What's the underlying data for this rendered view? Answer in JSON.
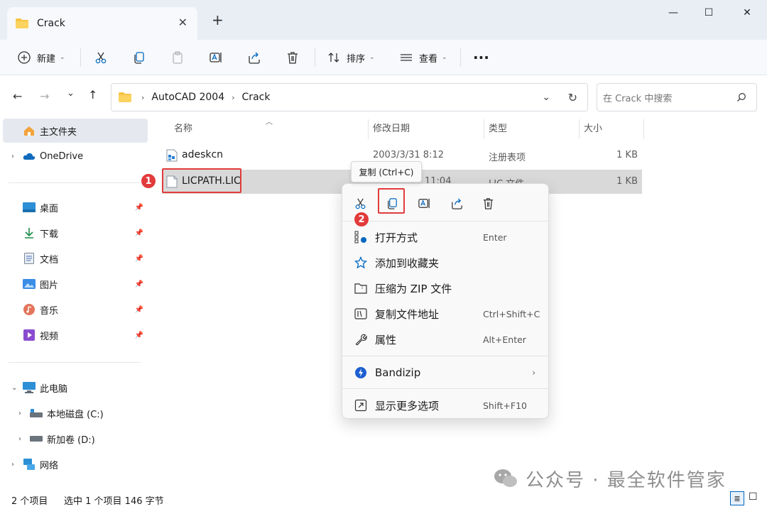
{
  "window": {
    "tab_title": "Crack",
    "new_tab": "+",
    "tab_close": "✕",
    "minimize": "—",
    "maximize": "☐",
    "close": "✕"
  },
  "toolbar": {
    "new_label": "新建",
    "sort_label": "排序",
    "view_label": "查看",
    "more": "···"
  },
  "address": {
    "segments": [
      "AutoCAD 2004",
      "Crack"
    ],
    "search_placeholder": "在 Crack 中搜索"
  },
  "sidebar": {
    "home": "主文件夹",
    "onedrive": "OneDrive",
    "quick": [
      {
        "label": "桌面",
        "icon": "desktop-icon"
      },
      {
        "label": "下载",
        "icon": "download-icon"
      },
      {
        "label": "文档",
        "icon": "document-icon"
      },
      {
        "label": "图片",
        "icon": "pictures-icon"
      },
      {
        "label": "音乐",
        "icon": "music-icon"
      },
      {
        "label": "视频",
        "icon": "video-icon"
      }
    ],
    "this_pc": "此电脑",
    "drives": [
      "本地磁盘 (C:)",
      "新加卷 (D:)"
    ],
    "network": "网络"
  },
  "columns": {
    "name": "名称",
    "date": "修改日期",
    "type": "类型",
    "size": "大小"
  },
  "files": [
    {
      "name": "adeskcn",
      "date": "2003/3/31 8:12",
      "type": "注册表项",
      "size": "1 KB"
    },
    {
      "name": "LICPATH.LIC",
      "date": "11:04",
      "type": "LIC 文件",
      "size": "1 KB"
    }
  ],
  "annotations": {
    "badge1": "1",
    "badge2": "2"
  },
  "tooltip": "复制 (Ctrl+C)",
  "context_menu": {
    "items": [
      {
        "label": "打开方式",
        "shortcut": "Enter"
      },
      {
        "label": "添加到收藏夹",
        "shortcut": ""
      },
      {
        "label": "压缩为 ZIP 文件",
        "shortcut": ""
      },
      {
        "label": "复制文件地址",
        "shortcut": "Ctrl+Shift+C"
      },
      {
        "label": "属性",
        "shortcut": "Alt+Enter"
      }
    ],
    "bandizip": "Bandizip",
    "more_options": {
      "label": "显示更多选项",
      "shortcut": "Shift+F10"
    }
  },
  "status": {
    "count": "2 个项目",
    "selection": "选中 1 个项目  146 字节"
  },
  "watermark": "公众号 · 最全软件管家",
  "colors": {
    "accent": "#0067c0",
    "highlight_red": "#e23b3b",
    "folder_yellow": "#f8c445"
  }
}
